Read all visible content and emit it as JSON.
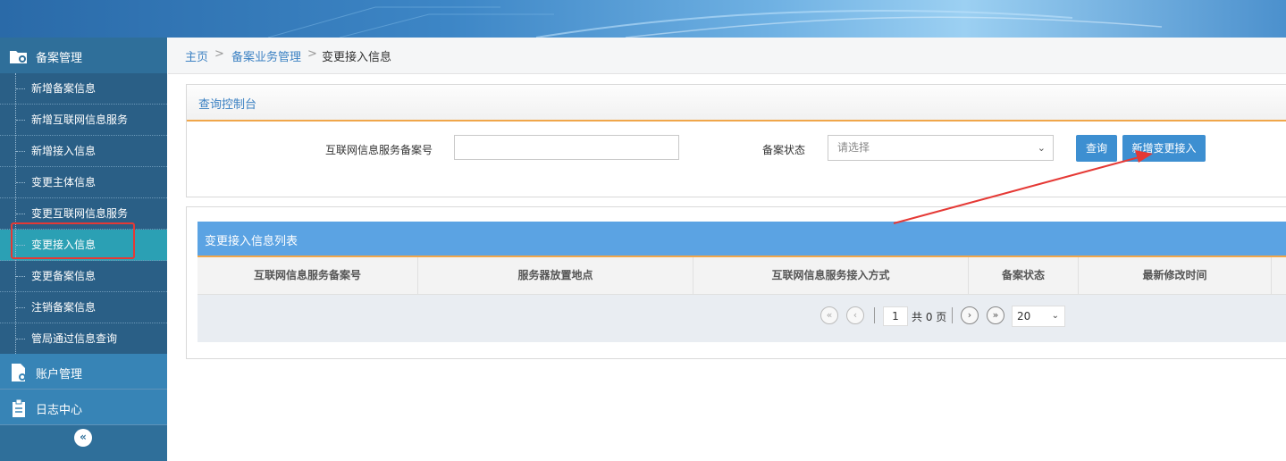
{
  "sidebar": {
    "group_beian": "备案管理",
    "items": [
      "新增备案信息",
      "新增互联网信息服务",
      "新增接入信息",
      "变更主体信息",
      "变更互联网信息服务",
      "变更接入信息",
      "变更备案信息",
      "注销备案信息",
      "管局通过信息查询"
    ],
    "active_index": 5,
    "group_account": "账户管理",
    "group_log": "日志中心",
    "collapse_icon": "«"
  },
  "breadcrumb": {
    "home": "主页",
    "section": "备案业务管理",
    "current": "变更接入信息",
    "sep": ">"
  },
  "query": {
    "title": "查询控制台",
    "field_number_label": "互联网信息服务备案号",
    "field_number_value": "",
    "field_status_label": "备案状态",
    "field_status_placeholder": "请选择",
    "search_button": "查询",
    "add_button": "新增变更接入"
  },
  "list": {
    "title": "变更接入信息列表",
    "columns": [
      "互联网信息服务备案号",
      "服务器放置地点",
      "互联网信息服务接入方式",
      "备案状态",
      "最新修改时间"
    ],
    "rows": []
  },
  "pagination": {
    "current_page": "1",
    "total_text": "共 0 页",
    "page_size": "20"
  },
  "colors": {
    "sidebar_bg": "#2f6f9a",
    "active_item": "#2ba0b4",
    "primary_button": "#3d8fd1",
    "list_header": "#5ba3e3",
    "accent_orange": "#f0a64a",
    "annotation_red": "#e53935"
  },
  "icons": {
    "beian": "folder-gear-icon",
    "account": "document-gear-icon",
    "log": "clipboard-icon"
  }
}
